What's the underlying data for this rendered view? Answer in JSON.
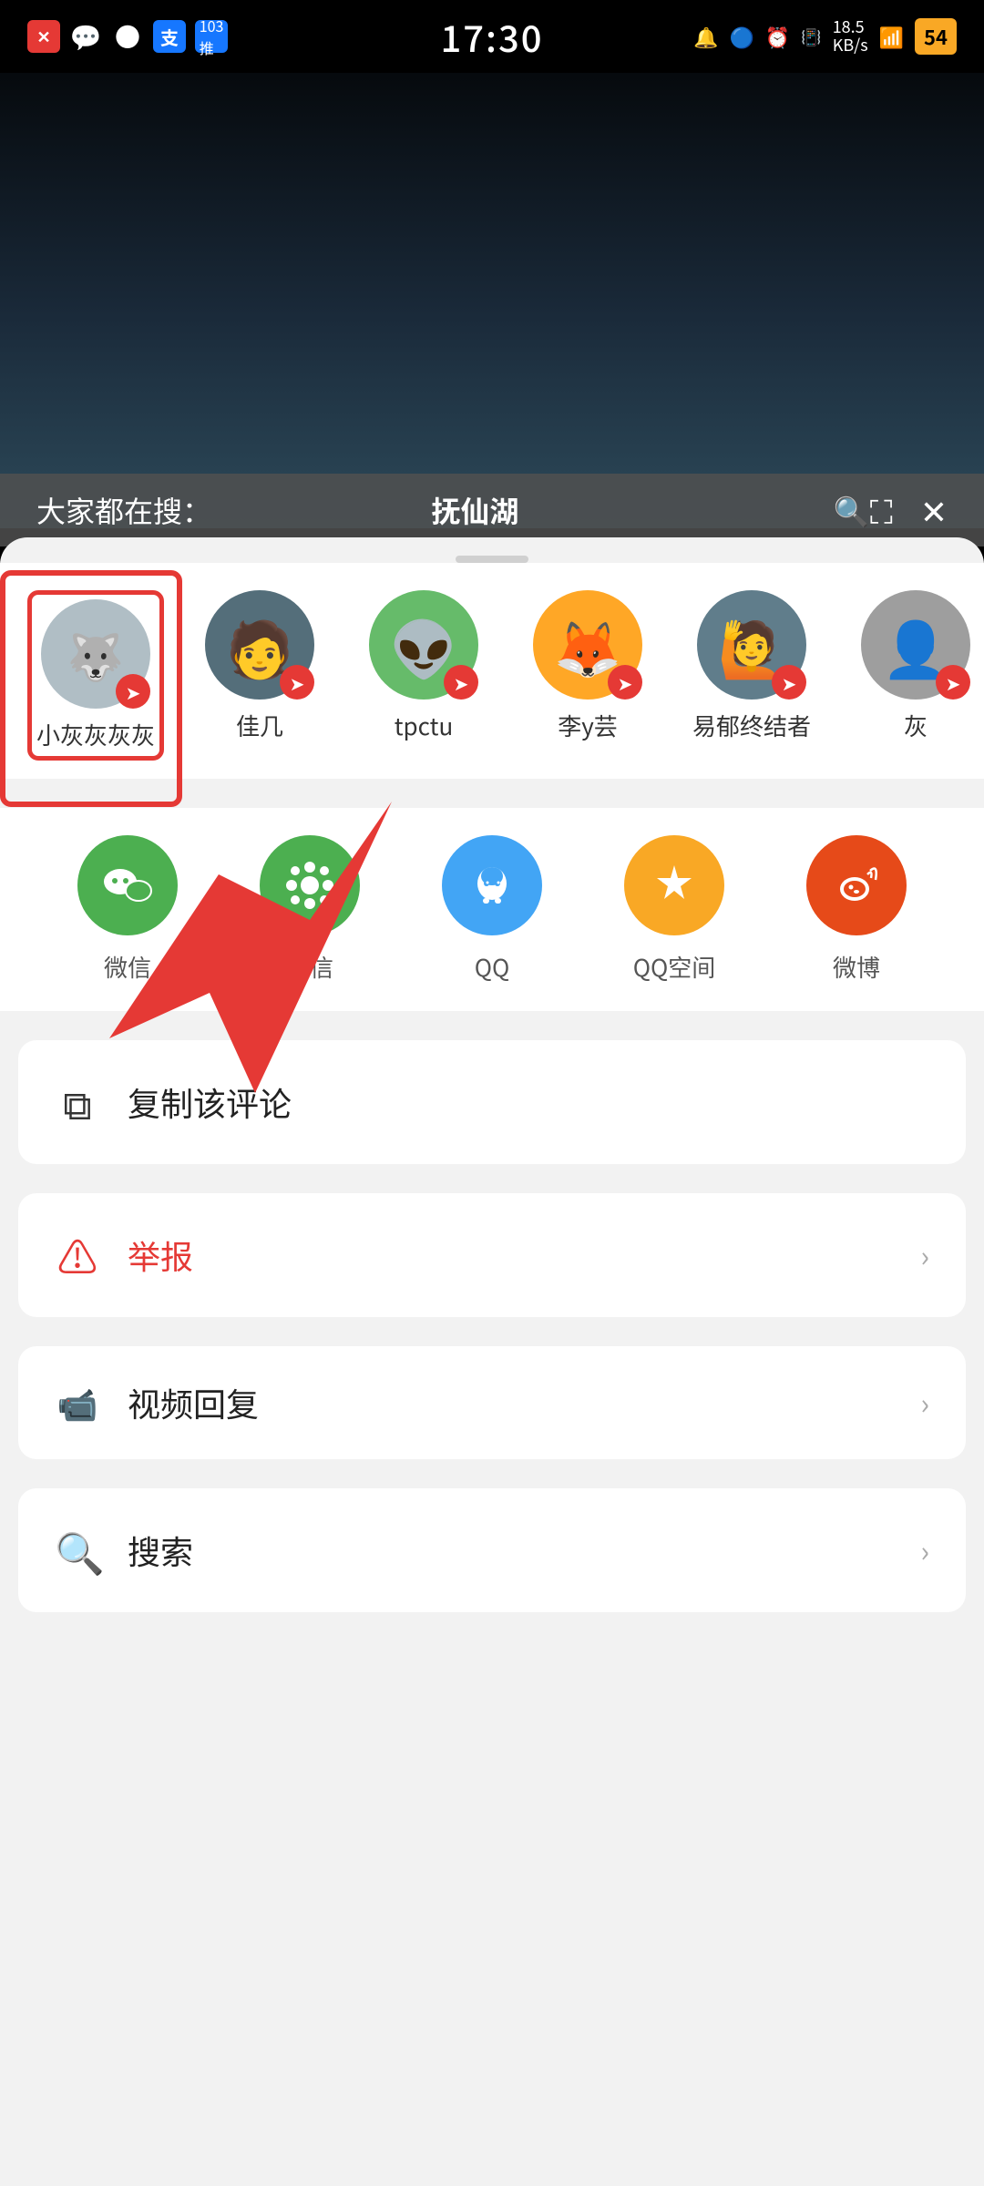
{
  "statusBar": {
    "time": "17:30",
    "battery": "54",
    "icons": [
      "✕",
      "💬",
      "●",
      "支"
    ]
  },
  "searchBar": {
    "prefix": "大家都在搜：",
    "keyword": "抚仙湖",
    "expandIcon": "⛶",
    "closeIcon": "✕"
  },
  "dragHandle": "",
  "contacts": [
    {
      "name": "小灰灰灰灰",
      "emoji": "🐺",
      "bg": "#b0bec5"
    },
    {
      "name": "佳几",
      "emoji": "🧑",
      "bg": "#78909c"
    },
    {
      "name": "tpctu",
      "emoji": "👽",
      "bg": "#66bb6a"
    },
    {
      "name": "李y芸",
      "emoji": "🦊",
      "bg": "#ffa726"
    },
    {
      "name": "易郁终结者",
      "emoji": "🙋",
      "bg": "#607d8b"
    },
    {
      "name": "灰",
      "emoji": "👤",
      "bg": "#9e9e9e"
    }
  ],
  "shareApps": [
    {
      "name": "微信",
      "icon": "💬",
      "bgClass": "bg-wechat"
    },
    {
      "name": "微信",
      "icon": "◑",
      "bgClass": "bg-wechat-moments"
    },
    {
      "name": "QQ",
      "icon": "🐧",
      "bgClass": "bg-qq"
    },
    {
      "name": "QQ空间",
      "icon": "⭐",
      "bgClass": "bg-qqzone"
    },
    {
      "name": "微博",
      "icon": "🌀",
      "bgClass": "bg-weibo"
    }
  ],
  "actions": [
    {
      "id": "copy",
      "icon": "⧉",
      "label": "复制该评论",
      "labelClass": "",
      "hasChevron": false,
      "isWarning": false
    },
    {
      "id": "report",
      "icon": "⚠",
      "label": "举报",
      "labelClass": "action-label-red",
      "hasChevron": true,
      "isWarning": true
    },
    {
      "id": "video-reply",
      "icon": "🎬",
      "label": "视频回复",
      "labelClass": "",
      "hasChevron": true,
      "isWarning": false
    },
    {
      "id": "search",
      "icon": "🔍",
      "label": "搜索",
      "labelClass": "",
      "hasChevron": true,
      "isWarning": false
    }
  ]
}
